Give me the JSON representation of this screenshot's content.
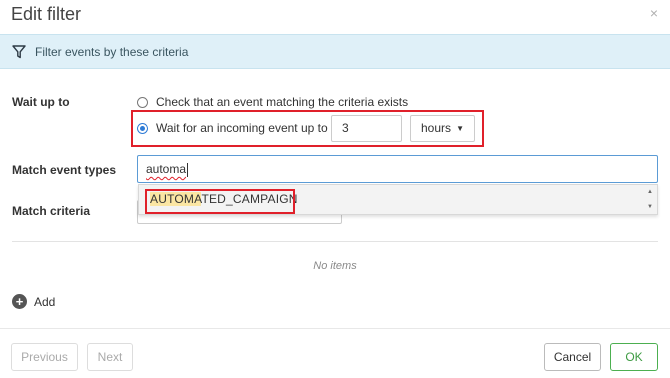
{
  "dialog": {
    "title": "Edit filter",
    "close_label": "×"
  },
  "info_bar": {
    "text": "Filter events by these criteria",
    "icon": "filter-icon"
  },
  "wait_up_to": {
    "label": "Wait up to",
    "option_check": "Check that an event matching the criteria exists",
    "option_wait": "Wait for an incoming event up to",
    "selected": "wait",
    "amount": "3",
    "unit": "hours",
    "unit_caret": "▼"
  },
  "match_event_types": {
    "label": "Match event types",
    "input_value": "automa"
  },
  "suggestion": {
    "option": "AUTOMATED_CAMPAIGN",
    "match_part": "AUTOMA",
    "rest_part": "TED_CAMPAIGN",
    "scroll_up": "▲",
    "scroll_down": "▼"
  },
  "match_criteria": {
    "label": "Match criteria",
    "empty_text": "No items",
    "add_label": "Add",
    "add_icon": "+"
  },
  "footer": {
    "previous": "Previous",
    "next": "Next",
    "cancel": "Cancel",
    "ok": "OK"
  },
  "colors": {
    "info_bar_bg": "#dff0f8",
    "highlight": "#e0202a",
    "ok_green": "#4caf50",
    "radio_blue": "#2e7bd6"
  }
}
